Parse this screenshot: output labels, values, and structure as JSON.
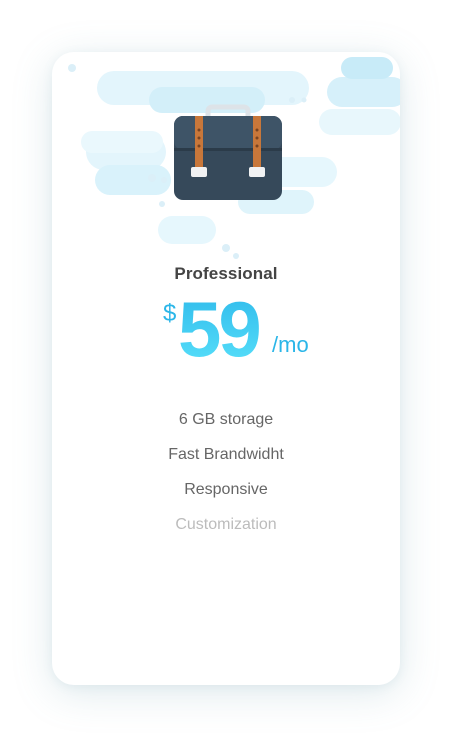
{
  "plan": {
    "name": "Professional",
    "currency": "$",
    "amount": "59",
    "period": "/mo",
    "icon": "briefcase-icon"
  },
  "features": [
    {
      "label": "6 GB storage",
      "available": true
    },
    {
      "label": "Fast Brandwidht",
      "available": true
    },
    {
      "label": "Responsive",
      "available": true
    },
    {
      "label": "Customization",
      "available": false
    }
  ],
  "colors": {
    "accent": "#2bb6e8",
    "accent_light": "#5ae2fb",
    "title": "#444444",
    "feature_text": "#666666",
    "feature_disabled": "#bcbcbc",
    "card_background": "#ffffff"
  }
}
